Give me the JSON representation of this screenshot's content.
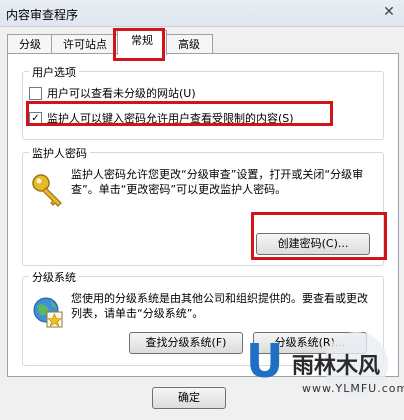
{
  "window": {
    "title": "内容审查程序",
    "close_glyph": "✕"
  },
  "tabs": [
    "分级",
    "许可站点",
    "常规",
    "高级"
  ],
  "user_options": {
    "label": "用户选项",
    "option1": "用户可以查看未分级的网站(U)",
    "option2": "监护人可以键入密码允许用户查看受限制的内容(S)"
  },
  "supervisor": {
    "label": "监护人密码",
    "description": "监护人密码允许您更改“分级审查”设置，打开或关闭“分级审查”。单击“更改密码”可以更改监护人密码。",
    "create_button": "创建密码(C)..."
  },
  "rating_systems": {
    "label": "分级系统",
    "description": "您使用的分级系统是由其他公司和组织提供的。要查看或更改列表，请单击“分级系统”。",
    "find_button": "查找分级系统(F)",
    "systems_button": "分级系统(R)..."
  },
  "footer": {
    "ok_button": "确定"
  },
  "watermark": {
    "letter": "U",
    "brand": "雨林木风",
    "url": "www.YLMFU.com"
  }
}
